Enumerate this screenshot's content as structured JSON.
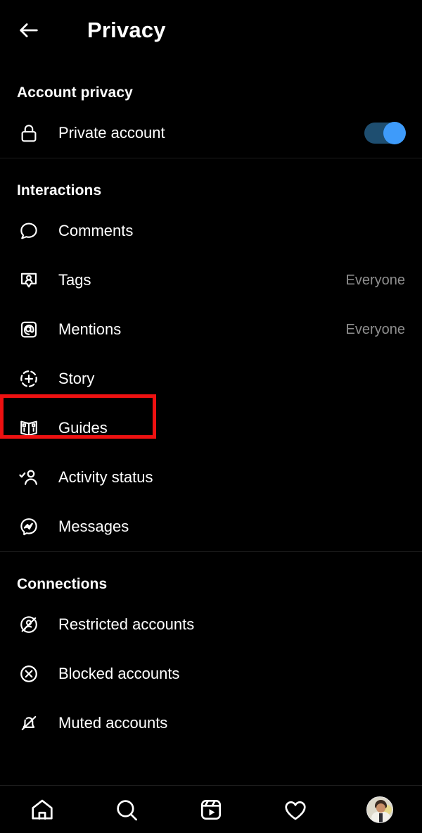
{
  "header": {
    "back_icon": "arrow-left-icon",
    "title": "Privacy"
  },
  "sections": [
    {
      "id": "account-privacy",
      "title": "Account privacy",
      "rows": [
        {
          "id": "private-account",
          "icon": "lock-icon",
          "label": "Private account",
          "control": "toggle",
          "toggle_on": true
        }
      ]
    },
    {
      "id": "interactions",
      "title": "Interactions",
      "rows": [
        {
          "id": "comments",
          "icon": "comment-bubble-icon",
          "label": "Comments",
          "value": ""
        },
        {
          "id": "tags",
          "icon": "tag-person-icon",
          "label": "Tags",
          "value": "Everyone"
        },
        {
          "id": "mentions",
          "icon": "at-mention-icon",
          "label": "Mentions",
          "value": "Everyone"
        },
        {
          "id": "story",
          "icon": "add-story-icon",
          "label": "Story",
          "value": "",
          "highlighted": true
        },
        {
          "id": "guides",
          "icon": "guides-book-icon",
          "label": "Guides",
          "value": ""
        },
        {
          "id": "activity-status",
          "icon": "person-check-icon",
          "label": "Activity status",
          "value": ""
        },
        {
          "id": "messages",
          "icon": "messenger-icon",
          "label": "Messages",
          "value": ""
        }
      ]
    },
    {
      "id": "connections",
      "title": "Connections",
      "rows": [
        {
          "id": "restricted-accounts",
          "icon": "restricted-person-icon",
          "label": "Restricted accounts",
          "value": ""
        },
        {
          "id": "blocked-accounts",
          "icon": "block-circle-icon",
          "label": "Blocked accounts",
          "value": ""
        },
        {
          "id": "muted-accounts",
          "icon": "bell-off-icon",
          "label": "Muted accounts",
          "value": ""
        }
      ]
    }
  ],
  "annotation": {
    "type": "highlight-rectangle",
    "target": "Story",
    "color": "#ee1111"
  },
  "bottom_nav": {
    "items": [
      {
        "id": "home",
        "icon": "home-icon"
      },
      {
        "id": "search",
        "icon": "search-icon"
      },
      {
        "id": "reels",
        "icon": "reels-icon"
      },
      {
        "id": "activity",
        "icon": "heart-icon"
      },
      {
        "id": "profile",
        "icon": "profile-avatar"
      }
    ]
  },
  "colors": {
    "background": "#000000",
    "text_primary": "#ffffff",
    "text_secondary": "#8e8e8e",
    "divider": "#1c1c1c",
    "toggle_on_track": "#1e4e70",
    "toggle_on_knob": "#3e9bfa",
    "highlight": "#ee1111"
  }
}
